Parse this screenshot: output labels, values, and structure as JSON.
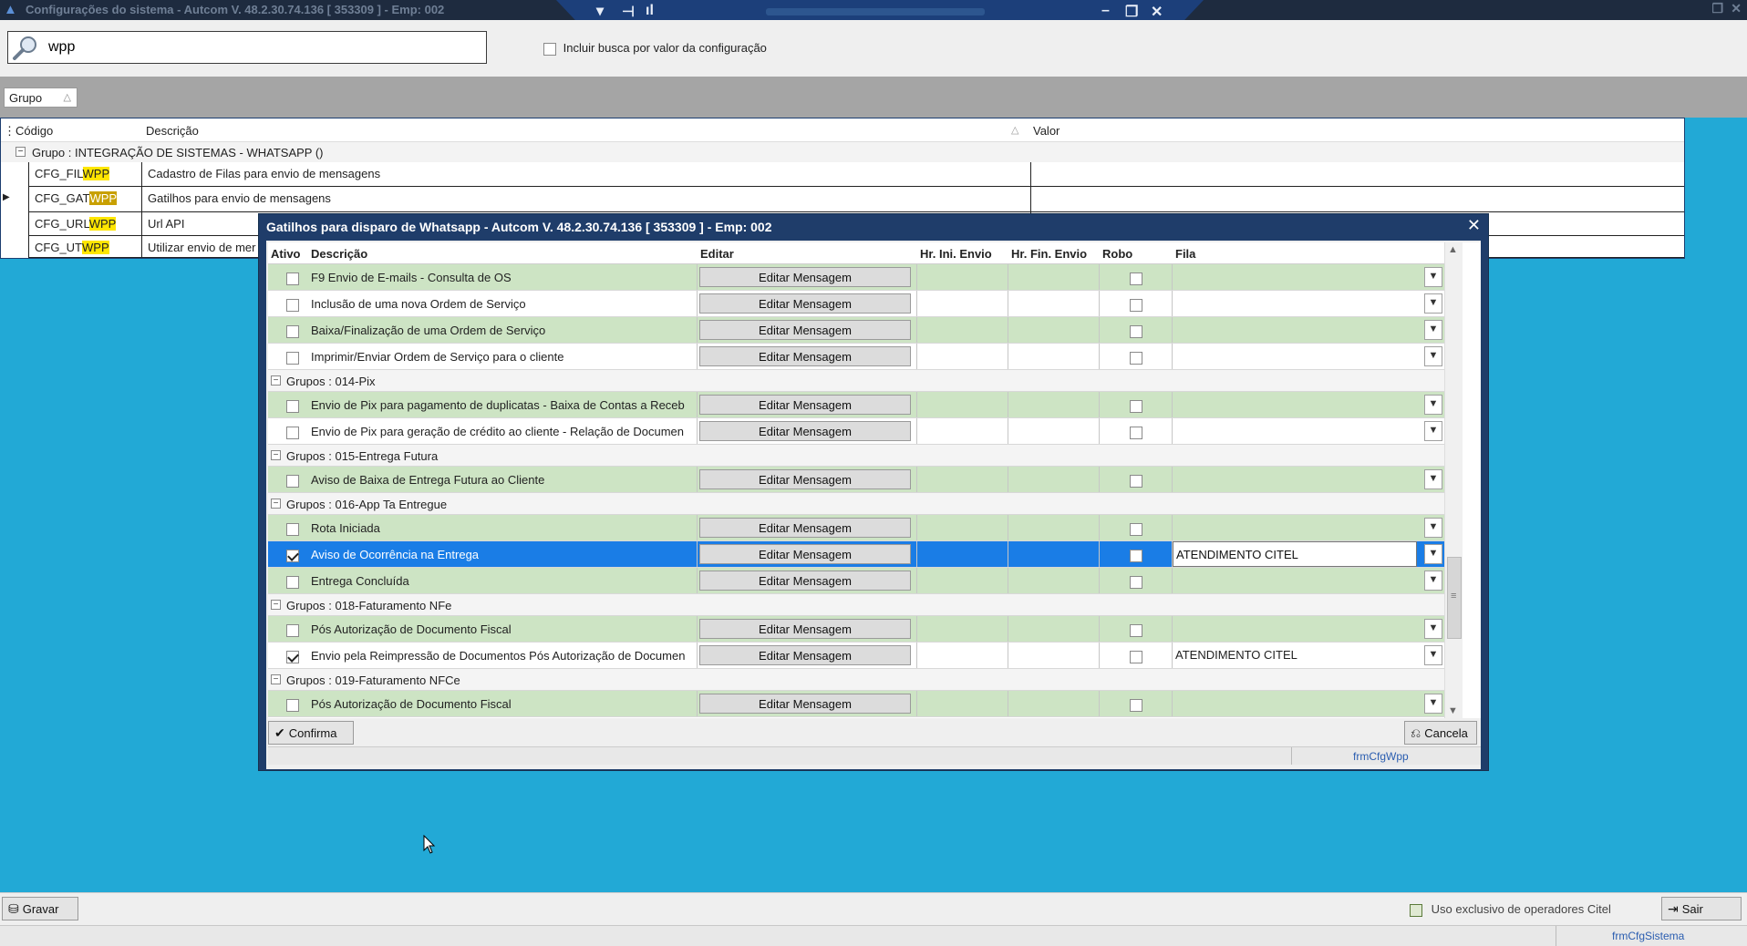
{
  "window": {
    "title": "Configurações do sistema  -  Autcom V. 48.2.30.74.136 [ 353309 ] - Emp: 002"
  },
  "search": {
    "value": "wpp",
    "include_value_label": "Incluir busca por valor da configuração"
  },
  "group_bar": {
    "chip_label": "Grupo"
  },
  "grid": {
    "headers": {
      "code": "Código",
      "description": "Descrição",
      "value": "Valor"
    },
    "group_label": "Grupo : INTEGRAÇÃO DE SISTEMAS - WHATSAPP ()",
    "rows": [
      {
        "code_prefix": "CFG_FIL",
        "code_hl": "WPP",
        "description": "Cadastro de Filas para envio de mensagens",
        "selected": false
      },
      {
        "code_prefix": "CFG_GAT",
        "code_hl": "WPP",
        "description": "Gatilhos para envio de mensagens",
        "selected": true
      },
      {
        "code_prefix": "CFG_URL",
        "code_hl": "WPP",
        "description": "Url API",
        "selected": false
      },
      {
        "code_prefix": "CFG_UT",
        "code_hl": "WPP",
        "description": "Utilizar envio de mer",
        "selected": false
      }
    ]
  },
  "dialog": {
    "title": "Gatilhos para disparo de Whatsapp   -   Autcom V. 48.2.30.74.136 [ 353309 ] - Emp: 002",
    "headers": {
      "ativo": "Ativo",
      "descricao": "Descrição",
      "editar": "Editar",
      "hr_ini": "Hr. Ini. Envio",
      "hr_fin": "Hr. Fin. Envio",
      "robo": "Robo",
      "fila": "Fila"
    },
    "edit_label": "Editar Mensagem",
    "rows": [
      {
        "kind": "row",
        "desc": "F9 Envio de E-mails - Consulta de OS",
        "checked": false,
        "fila": ""
      },
      {
        "kind": "row",
        "desc": "Inclusão de uma nova Ordem de Serviço",
        "checked": false,
        "fila": ""
      },
      {
        "kind": "row",
        "desc": "Baixa/Finalização de uma Ordem de Serviço",
        "checked": false,
        "fila": ""
      },
      {
        "kind": "row",
        "desc": "Imprimir/Enviar Ordem de Serviço para o cliente",
        "checked": false,
        "fila": ""
      },
      {
        "kind": "group",
        "label": "Grupos : 014-Pix"
      },
      {
        "kind": "row",
        "desc": "Envio de Pix para pagamento de duplicatas - Baixa de Contas a Receb",
        "checked": false,
        "fila": ""
      },
      {
        "kind": "row",
        "desc": "Envio de Pix para geração de crédito ao cliente - Relação de Documen",
        "checked": false,
        "fila": ""
      },
      {
        "kind": "group",
        "label": "Grupos : 015-Entrega Futura"
      },
      {
        "kind": "row",
        "desc": "Aviso de Baixa de Entrega Futura ao Cliente",
        "checked": false,
        "fila": ""
      },
      {
        "kind": "group",
        "label": "Grupos : 016-App Ta Entregue"
      },
      {
        "kind": "row",
        "desc": "Rota Iniciada",
        "checked": false,
        "fila": ""
      },
      {
        "kind": "row",
        "desc": "Aviso de Ocorrência na Entrega",
        "checked": true,
        "fila": "ATENDIMENTO CITEL",
        "selected": true
      },
      {
        "kind": "row",
        "desc": "Entrega Concluída",
        "checked": false,
        "fila": ""
      },
      {
        "kind": "group",
        "label": "Grupos : 018-Faturamento NFe"
      },
      {
        "kind": "row",
        "desc": "Pós Autorização de Documento Fiscal",
        "checked": false,
        "fila": ""
      },
      {
        "kind": "row",
        "desc": "Envio pela Reimpressão de Documentos Pós Autorização de Documen",
        "checked": true,
        "fila": "ATENDIMENTO CITEL"
      },
      {
        "kind": "group",
        "label": "Grupos : 019-Faturamento NFCe"
      },
      {
        "kind": "row",
        "desc": "Pós Autorização de Documento Fiscal",
        "checked": false,
        "fila": ""
      }
    ],
    "confirm_label": "Confirma",
    "cancel_label": "Cancela",
    "form_name": "frmCfgWpp"
  },
  "bottom": {
    "save_label": "Gravar",
    "exclusive_label": "Uso exclusivo de operadores Citel",
    "exit_label": "Sair",
    "form_name": "frmCfgSistema"
  },
  "colors": {
    "desktop": "#22a9d6",
    "row_green": "#cde4c4",
    "row_selected": "#1a7de6",
    "dialog_frame": "#1f3d6a",
    "highlight": "#ffe600"
  }
}
